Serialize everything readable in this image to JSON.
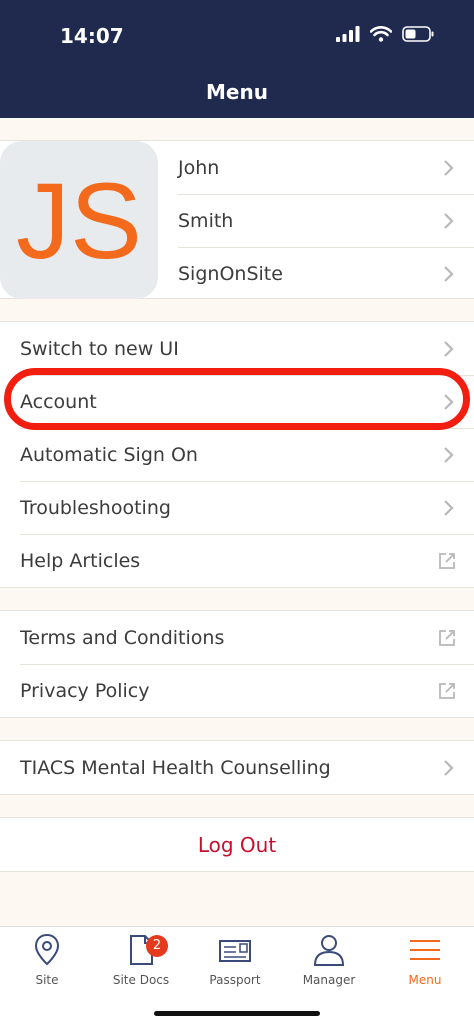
{
  "status": {
    "time": "14:07"
  },
  "header": {
    "title": "Menu"
  },
  "profile": {
    "initials": "JS",
    "first_name": "John",
    "last_name": "Smith",
    "company": "SignOnSite"
  },
  "menu": {
    "switch_ui": "Switch to new UI",
    "account": "Account",
    "automatic_sign_on": "Automatic Sign On",
    "troubleshooting": "Troubleshooting",
    "help_articles": "Help Articles",
    "terms": "Terms and Conditions",
    "privacy": "Privacy Policy",
    "tiacs": "TIACS Mental Health Counselling",
    "logout": "Log Out"
  },
  "tabs": [
    {
      "label": "Site",
      "icon": "map-pin-icon"
    },
    {
      "label": "Site Docs",
      "icon": "document-icon",
      "badge": "2"
    },
    {
      "label": "Passport",
      "icon": "passport-icon"
    },
    {
      "label": "Manager",
      "icon": "person-icon"
    },
    {
      "label": "Menu",
      "icon": "hamburger-icon",
      "active": true
    }
  ],
  "colors": {
    "nav": "#1f2a4e",
    "accent": "#f36a1d",
    "highlight": "#f21f10",
    "logout": "#c8102e"
  }
}
